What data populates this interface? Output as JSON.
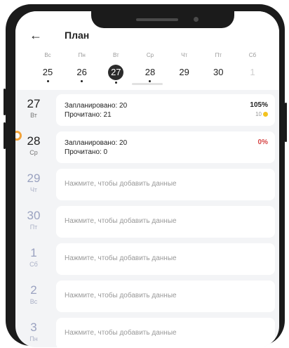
{
  "header": {
    "back_icon": "arrow-left-icon",
    "title": "План"
  },
  "week": [
    {
      "name": "Вс",
      "date": "25",
      "dot": true,
      "selected": false,
      "muted": false
    },
    {
      "name": "Пн",
      "date": "26",
      "dot": true,
      "selected": false,
      "muted": false
    },
    {
      "name": "Вт",
      "date": "27",
      "dot": true,
      "selected": true,
      "muted": false
    },
    {
      "name": "Ср",
      "date": "28",
      "dot": true,
      "selected": false,
      "muted": false
    },
    {
      "name": "Чт",
      "date": "29",
      "dot": false,
      "selected": false,
      "muted": false
    },
    {
      "name": "Пт",
      "date": "30",
      "dot": false,
      "selected": false,
      "muted": false
    },
    {
      "name": "Сб",
      "date": "1",
      "dot": false,
      "selected": false,
      "muted": true
    }
  ],
  "rows": [
    {
      "day": "27",
      "weekday": "Вт",
      "planned": "Запланировано: 20",
      "read": "Прочитано: 21",
      "percent": "105%",
      "coins": "10",
      "state": "done"
    },
    {
      "day": "28",
      "weekday": "Ср",
      "planned": "Запланировано: 20",
      "read": "Прочитано: 0",
      "percent": "0%",
      "state": "planned"
    },
    {
      "day": "29",
      "weekday": "Чт",
      "empty": "Нажмите, чтобы добавить данные",
      "state": "empty"
    },
    {
      "day": "30",
      "weekday": "Пт",
      "empty": "Нажмите, чтобы добавить данные",
      "state": "empty"
    },
    {
      "day": "1",
      "weekday": "Сб",
      "empty": "Нажмите, чтобы добавить данные",
      "state": "empty"
    },
    {
      "day": "2",
      "weekday": "Вс",
      "empty": "Нажмите, чтобы добавить данные",
      "state": "empty"
    },
    {
      "day": "3",
      "weekday": "Пн",
      "empty": "Нажмите, чтобы добавить данные",
      "state": "empty"
    }
  ],
  "colors": {
    "accent_red": "#d64545",
    "coin": "#f3c31f",
    "selected_day": "#2b2b2b"
  }
}
